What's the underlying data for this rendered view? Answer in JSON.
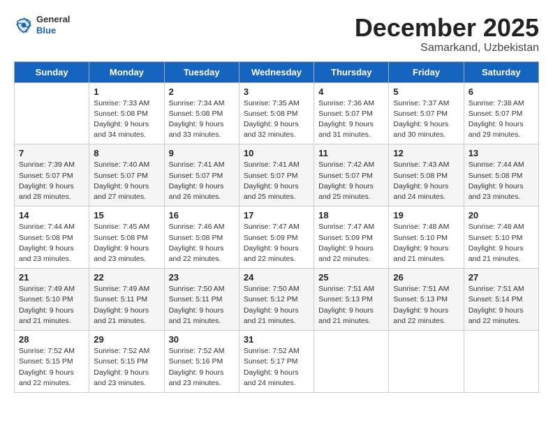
{
  "header": {
    "logo_general": "General",
    "logo_blue": "Blue",
    "month": "December 2025",
    "location": "Samarkand, Uzbekistan"
  },
  "days_of_week": [
    "Sunday",
    "Monday",
    "Tuesday",
    "Wednesday",
    "Thursday",
    "Friday",
    "Saturday"
  ],
  "weeks": [
    [
      {
        "day": "",
        "sunrise": "",
        "sunset": "",
        "daylight": ""
      },
      {
        "day": "1",
        "sunrise": "Sunrise: 7:33 AM",
        "sunset": "Sunset: 5:08 PM",
        "daylight": "Daylight: 9 hours and 34 minutes."
      },
      {
        "day": "2",
        "sunrise": "Sunrise: 7:34 AM",
        "sunset": "Sunset: 5:08 PM",
        "daylight": "Daylight: 9 hours and 33 minutes."
      },
      {
        "day": "3",
        "sunrise": "Sunrise: 7:35 AM",
        "sunset": "Sunset: 5:08 PM",
        "daylight": "Daylight: 9 hours and 32 minutes."
      },
      {
        "day": "4",
        "sunrise": "Sunrise: 7:36 AM",
        "sunset": "Sunset: 5:07 PM",
        "daylight": "Daylight: 9 hours and 31 minutes."
      },
      {
        "day": "5",
        "sunrise": "Sunrise: 7:37 AM",
        "sunset": "Sunset: 5:07 PM",
        "daylight": "Daylight: 9 hours and 30 minutes."
      },
      {
        "day": "6",
        "sunrise": "Sunrise: 7:38 AM",
        "sunset": "Sunset: 5:07 PM",
        "daylight": "Daylight: 9 hours and 29 minutes."
      }
    ],
    [
      {
        "day": "7",
        "sunrise": "Sunrise: 7:39 AM",
        "sunset": "Sunset: 5:07 PM",
        "daylight": "Daylight: 9 hours and 28 minutes."
      },
      {
        "day": "8",
        "sunrise": "Sunrise: 7:40 AM",
        "sunset": "Sunset: 5:07 PM",
        "daylight": "Daylight: 9 hours and 27 minutes."
      },
      {
        "day": "9",
        "sunrise": "Sunrise: 7:41 AM",
        "sunset": "Sunset: 5:07 PM",
        "daylight": "Daylight: 9 hours and 26 minutes."
      },
      {
        "day": "10",
        "sunrise": "Sunrise: 7:41 AM",
        "sunset": "Sunset: 5:07 PM",
        "daylight": "Daylight: 9 hours and 25 minutes."
      },
      {
        "day": "11",
        "sunrise": "Sunrise: 7:42 AM",
        "sunset": "Sunset: 5:07 PM",
        "daylight": "Daylight: 9 hours and 25 minutes."
      },
      {
        "day": "12",
        "sunrise": "Sunrise: 7:43 AM",
        "sunset": "Sunset: 5:08 PM",
        "daylight": "Daylight: 9 hours and 24 minutes."
      },
      {
        "day": "13",
        "sunrise": "Sunrise: 7:44 AM",
        "sunset": "Sunset: 5:08 PM",
        "daylight": "Daylight: 9 hours and 23 minutes."
      }
    ],
    [
      {
        "day": "14",
        "sunrise": "Sunrise: 7:44 AM",
        "sunset": "Sunset: 5:08 PM",
        "daylight": "Daylight: 9 hours and 23 minutes."
      },
      {
        "day": "15",
        "sunrise": "Sunrise: 7:45 AM",
        "sunset": "Sunset: 5:08 PM",
        "daylight": "Daylight: 9 hours and 23 minutes."
      },
      {
        "day": "16",
        "sunrise": "Sunrise: 7:46 AM",
        "sunset": "Sunset: 5:08 PM",
        "daylight": "Daylight: 9 hours and 22 minutes."
      },
      {
        "day": "17",
        "sunrise": "Sunrise: 7:47 AM",
        "sunset": "Sunset: 5:09 PM",
        "daylight": "Daylight: 9 hours and 22 minutes."
      },
      {
        "day": "18",
        "sunrise": "Sunrise: 7:47 AM",
        "sunset": "Sunset: 5:09 PM",
        "daylight": "Daylight: 9 hours and 22 minutes."
      },
      {
        "day": "19",
        "sunrise": "Sunrise: 7:48 AM",
        "sunset": "Sunset: 5:10 PM",
        "daylight": "Daylight: 9 hours and 21 minutes."
      },
      {
        "day": "20",
        "sunrise": "Sunrise: 7:48 AM",
        "sunset": "Sunset: 5:10 PM",
        "daylight": "Daylight: 9 hours and 21 minutes."
      }
    ],
    [
      {
        "day": "21",
        "sunrise": "Sunrise: 7:49 AM",
        "sunset": "Sunset: 5:10 PM",
        "daylight": "Daylight: 9 hours and 21 minutes."
      },
      {
        "day": "22",
        "sunrise": "Sunrise: 7:49 AM",
        "sunset": "Sunset: 5:11 PM",
        "daylight": "Daylight: 9 hours and 21 minutes."
      },
      {
        "day": "23",
        "sunrise": "Sunrise: 7:50 AM",
        "sunset": "Sunset: 5:11 PM",
        "daylight": "Daylight: 9 hours and 21 minutes."
      },
      {
        "day": "24",
        "sunrise": "Sunrise: 7:50 AM",
        "sunset": "Sunset: 5:12 PM",
        "daylight": "Daylight: 9 hours and 21 minutes."
      },
      {
        "day": "25",
        "sunrise": "Sunrise: 7:51 AM",
        "sunset": "Sunset: 5:13 PM",
        "daylight": "Daylight: 9 hours and 21 minutes."
      },
      {
        "day": "26",
        "sunrise": "Sunrise: 7:51 AM",
        "sunset": "Sunset: 5:13 PM",
        "daylight": "Daylight: 9 hours and 22 minutes."
      },
      {
        "day": "27",
        "sunrise": "Sunrise: 7:51 AM",
        "sunset": "Sunset: 5:14 PM",
        "daylight": "Daylight: 9 hours and 22 minutes."
      }
    ],
    [
      {
        "day": "28",
        "sunrise": "Sunrise: 7:52 AM",
        "sunset": "Sunset: 5:15 PM",
        "daylight": "Daylight: 9 hours and 22 minutes."
      },
      {
        "day": "29",
        "sunrise": "Sunrise: 7:52 AM",
        "sunset": "Sunset: 5:15 PM",
        "daylight": "Daylight: 9 hours and 23 minutes."
      },
      {
        "day": "30",
        "sunrise": "Sunrise: 7:52 AM",
        "sunset": "Sunset: 5:16 PM",
        "daylight": "Daylight: 9 hours and 23 minutes."
      },
      {
        "day": "31",
        "sunrise": "Sunrise: 7:52 AM",
        "sunset": "Sunset: 5:17 PM",
        "daylight": "Daylight: 9 hours and 24 minutes."
      },
      {
        "day": "",
        "sunrise": "",
        "sunset": "",
        "daylight": ""
      },
      {
        "day": "",
        "sunrise": "",
        "sunset": "",
        "daylight": ""
      },
      {
        "day": "",
        "sunrise": "",
        "sunset": "",
        "daylight": ""
      }
    ]
  ]
}
